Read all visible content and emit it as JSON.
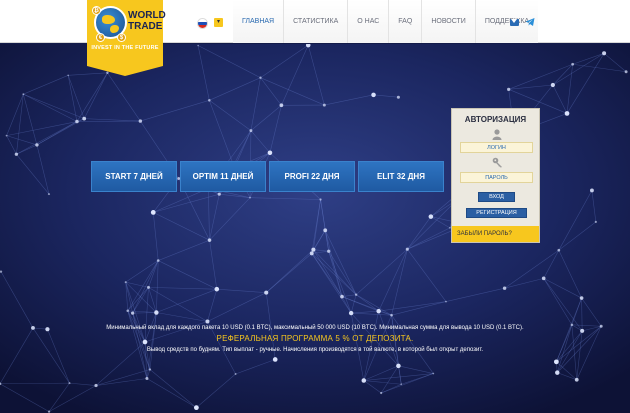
{
  "brand": {
    "name": "WORLD\nTRADE",
    "tagline": "INVEST IN THE FUTURE",
    "accent": "#f7c71e",
    "primary_blue": "#2a6ab0",
    "background": "#141c4a"
  },
  "language": {
    "selected_icon": "russia-flag-icon",
    "dropdown_glyph": "▾"
  },
  "nav": {
    "items": [
      {
        "label": "ГЛАВНАЯ",
        "active": true
      },
      {
        "label": "СТАТИСТИКА",
        "active": false
      },
      {
        "label": "О НАС",
        "active": false
      },
      {
        "label": "FAQ",
        "active": false
      },
      {
        "label": "НОВОСТИ",
        "active": false
      },
      {
        "label": "ПОДДЕРЖКА",
        "active": false
      }
    ],
    "icons": [
      "home-icon",
      "mail-icon",
      "telegram-icon"
    ]
  },
  "plans": [
    {
      "label": "START 7 ДНЕЙ"
    },
    {
      "label": "OPTIM 11 ДНЕЙ"
    },
    {
      "label": "PROFI 22 ДНЯ"
    },
    {
      "label": "ELIT 32 ДНЯ"
    }
  ],
  "auth": {
    "title": "АВТОРИЗАЦИЯ",
    "login_placeholder": "ЛОГИН",
    "password_placeholder": "ПАРОЛЬ",
    "login_button": "ВХОД",
    "register_button": "РЕГИСТРАЦИЯ",
    "forgot_link": "ЗАБЫЛИ ПАРОЛЬ?"
  },
  "info": {
    "line1": "Минимальный вклад для каждого пакета 10 USD (0.1 BTC), максимальный 50 000 USD (10 BTC). Минимальная сумма для вывода 10 USD (0.1 BTC).",
    "line2": "РЕФЕРАЛЬНАЯ ПРОГРАММА 5 % ОТ ДЕПОЗИТА.",
    "line3": "Вывод средств по будням. Тип выплат - ручные. Начисления производятся в той валюте, в которой был открыт депозит."
  }
}
